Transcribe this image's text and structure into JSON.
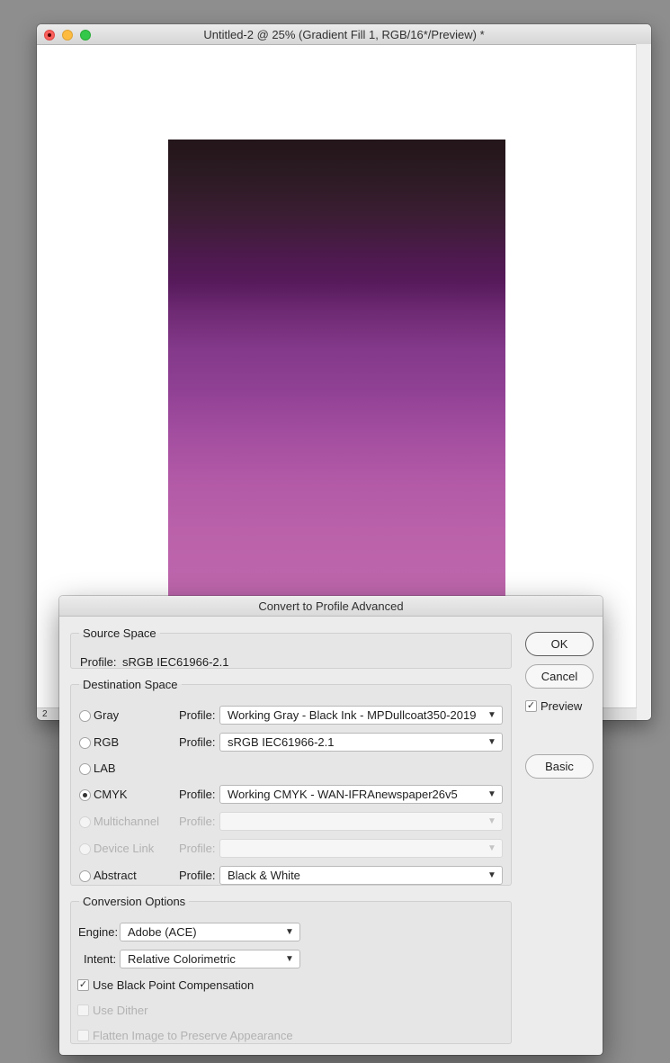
{
  "document": {
    "title": "Untitled-2 @ 25% (Gradient Fill 1, RGB/16*/Preview) *",
    "status_zoom": "2"
  },
  "dialog": {
    "title": "Convert to Profile Advanced",
    "source_space": {
      "legend": "Source Space",
      "profile_label": "Profile:",
      "profile_value": "sRGB IEC61966-2.1"
    },
    "destination_space": {
      "legend": "Destination Space",
      "profile_label": "Profile:",
      "options": [
        {
          "label": "Gray",
          "profile": "Working Gray - Black Ink - MPDullcoat350-2019",
          "selected": false,
          "enabled": true
        },
        {
          "label": "RGB",
          "profile": "sRGB IEC61966-2.1",
          "selected": false,
          "enabled": true
        },
        {
          "label": "LAB",
          "profile": "",
          "selected": false,
          "enabled": true
        },
        {
          "label": "CMYK",
          "profile": "Working CMYK - WAN-IFRAnewspaper26v5",
          "selected": true,
          "enabled": true
        },
        {
          "label": "Multichannel",
          "profile": "",
          "selected": false,
          "enabled": false
        },
        {
          "label": "Device Link",
          "profile": "",
          "selected": false,
          "enabled": false
        },
        {
          "label": "Abstract",
          "profile": "Black & White",
          "selected": false,
          "enabled": true
        }
      ]
    },
    "conversion_options": {
      "legend": "Conversion Options",
      "engine_label": "Engine:",
      "engine_value": "Adobe (ACE)",
      "intent_label": "Intent:",
      "intent_value": "Relative Colorimetric",
      "use_black_point": "Use Black Point Compensation",
      "use_dither": "Use Dither",
      "flatten": "Flatten Image to Preserve Appearance"
    },
    "buttons": {
      "ok": "OK",
      "cancel": "Cancel",
      "basic": "Basic"
    },
    "preview_label": "Preview",
    "preview_checked": true,
    "black_point_checked": true
  }
}
